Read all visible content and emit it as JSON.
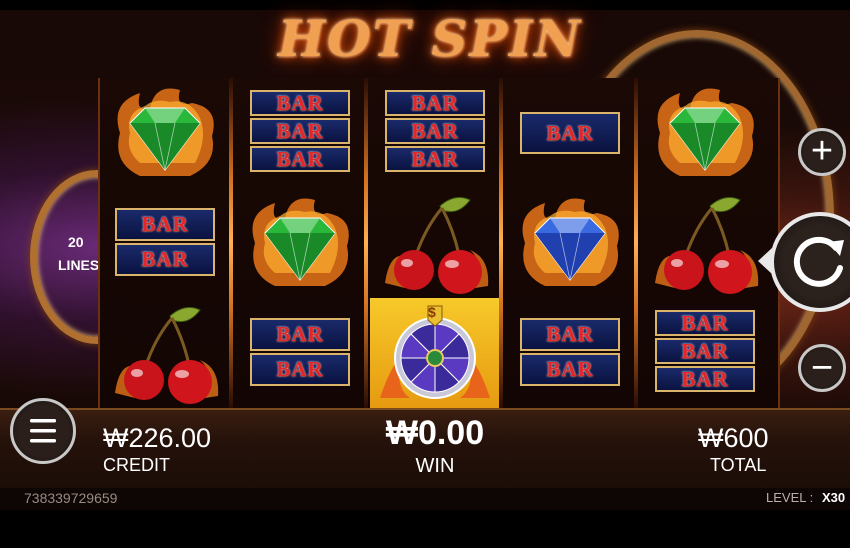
{
  "game": {
    "title": "HOT SPIN",
    "lines_count": "20",
    "lines_label": "LINES"
  },
  "reels": [
    [
      "green-diamond",
      "bar-double",
      "cherry"
    ],
    [
      "bar-triple",
      "green-diamond",
      "bar-double"
    ],
    [
      "bar-triple",
      "cherry",
      "wheel-bonus"
    ],
    [
      "bar-single",
      "blue-diamond",
      "bar-double"
    ],
    [
      "green-diamond",
      "cherry",
      "bar-triple"
    ]
  ],
  "bar_text": "BAR",
  "wheel_symbol": "$",
  "hud": {
    "credit_amount": "₩226.00",
    "credit_label": "CREDIT",
    "win_amount": "₩0.00",
    "win_label": "WIN",
    "total_amount": "₩600",
    "total_label": "TOTAL"
  },
  "footer": {
    "session_id": "738339729659",
    "level_label": "LEVEL :",
    "level_value": "X30"
  },
  "controls": {
    "menu_icon": "menu-icon",
    "increase_icon": "plus-icon",
    "spin_icon": "spin-refresh-icon",
    "decrease_icon": "minus-icon",
    "plus_glyph": "+",
    "minus_glyph": "−"
  },
  "colors": {
    "bar_text": "#e3262a",
    "bar_bg": "#0a1240",
    "gold": "#d9b46a",
    "highlight": "#f7c92a"
  }
}
